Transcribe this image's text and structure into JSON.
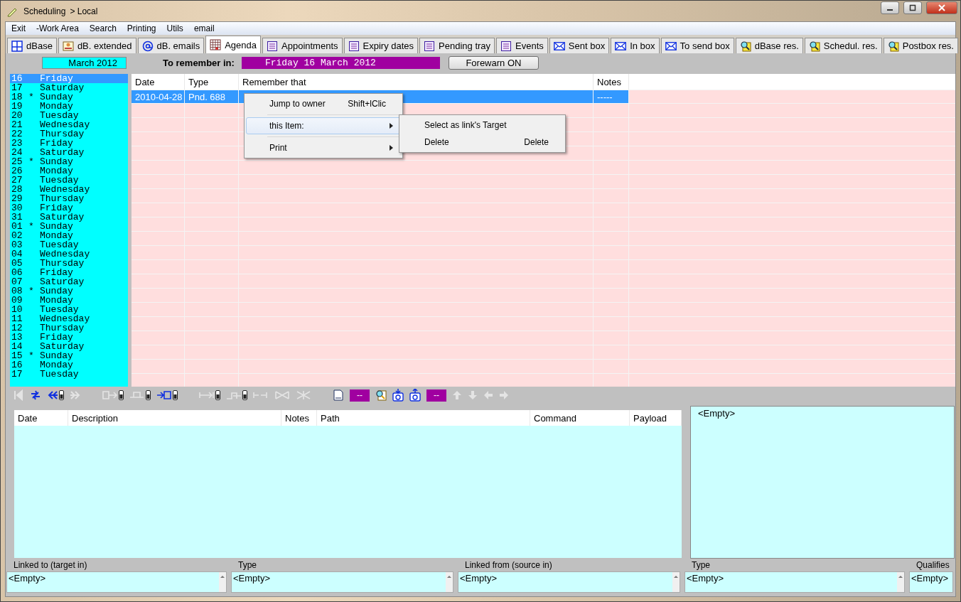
{
  "window": {
    "title": "Scheduling",
    "location": "> Local"
  },
  "menu": [
    "Exit",
    "-Work Area",
    "Search",
    "Printing",
    "Utils",
    "email"
  ],
  "tabs": [
    {
      "label": "dBase",
      "kind": "grid",
      "selected": false
    },
    {
      "label": "dB. extended",
      "kind": "card",
      "selected": false
    },
    {
      "label": "dB. emails",
      "kind": "at",
      "selected": false
    },
    {
      "label": "Agenda",
      "kind": "calendar",
      "selected": true
    },
    {
      "label": "Appointments",
      "kind": "page",
      "selected": false
    },
    {
      "label": "Expiry dates",
      "kind": "page",
      "selected": false
    },
    {
      "label": "Pending tray",
      "kind": "page",
      "selected": false
    },
    {
      "label": "Events",
      "kind": "page",
      "selected": false
    },
    {
      "label": "Sent box",
      "kind": "mail",
      "selected": false
    },
    {
      "label": "In box",
      "kind": "mail",
      "selected": false
    },
    {
      "label": "To send box",
      "kind": "mail",
      "selected": false
    },
    {
      "label": "dBase res.",
      "kind": "find",
      "selected": false
    },
    {
      "label": "Schedul. res.",
      "kind": "find",
      "selected": false
    },
    {
      "label": "Postbox res.",
      "kind": "find",
      "selected": false
    }
  ],
  "header": {
    "month": "March 2012",
    "remember_label": "To remember in:",
    "remember_date": "Friday 16 March 2012",
    "forewarn_button": "Forewarn ON"
  },
  "days": [
    {
      "day": "16",
      "weekday": "Friday",
      "selected": true
    },
    {
      "day": "17",
      "weekday": "Saturday",
      "selected": false
    },
    {
      "day": "18",
      "weekday": "Sunday",
      "mark": "*",
      "selected": false
    },
    {
      "day": "19",
      "weekday": "Monday",
      "selected": false
    },
    {
      "day": "20",
      "weekday": "Tuesday",
      "selected": false
    },
    {
      "day": "21",
      "weekday": "Wednesday",
      "selected": false
    },
    {
      "day": "22",
      "weekday": "Thursday",
      "selected": false
    },
    {
      "day": "23",
      "weekday": "Friday",
      "selected": false
    },
    {
      "day": "24",
      "weekday": "Saturday",
      "selected": false
    },
    {
      "day": "25",
      "weekday": "Sunday",
      "mark": "*",
      "selected": false
    },
    {
      "day": "26",
      "weekday": "Monday",
      "selected": false
    },
    {
      "day": "27",
      "weekday": "Tuesday",
      "selected": false
    },
    {
      "day": "28",
      "weekday": "Wednesday",
      "selected": false
    },
    {
      "day": "29",
      "weekday": "Thursday",
      "selected": false
    },
    {
      "day": "30",
      "weekday": "Friday",
      "selected": false
    },
    {
      "day": "31",
      "weekday": "Saturday",
      "selected": false
    },
    {
      "day": "01",
      "weekday": "Sunday",
      "mark": "*",
      "selected": false
    },
    {
      "day": "02",
      "weekday": "Monday",
      "selected": false
    },
    {
      "day": "03",
      "weekday": "Tuesday",
      "selected": false
    },
    {
      "day": "04",
      "weekday": "Wednesday",
      "selected": false
    },
    {
      "day": "05",
      "weekday": "Thursday",
      "selected": false
    },
    {
      "day": "06",
      "weekday": "Friday",
      "selected": false
    },
    {
      "day": "07",
      "weekday": "Saturday",
      "selected": false
    },
    {
      "day": "08",
      "weekday": "Sunday",
      "mark": "*",
      "selected": false
    },
    {
      "day": "09",
      "weekday": "Monday",
      "selected": false
    },
    {
      "day": "10",
      "weekday": "Tuesday",
      "selected": false
    },
    {
      "day": "11",
      "weekday": "Wednesday",
      "selected": false
    },
    {
      "day": "12",
      "weekday": "Thursday",
      "selected": false
    },
    {
      "day": "13",
      "weekday": "Friday",
      "selected": false
    },
    {
      "day": "14",
      "weekday": "Saturday",
      "selected": false
    },
    {
      "day": "15",
      "weekday": "Sunday",
      "mark": "*",
      "selected": false
    },
    {
      "day": "16",
      "weekday": "Monday",
      "selected": false
    },
    {
      "day": "17",
      "weekday": "Tuesday",
      "selected": false
    }
  ],
  "agenda_table": {
    "columns": [
      "Date",
      "Type",
      "Remember that",
      "Notes"
    ],
    "rows": [
      {
        "cells": [
          "2010-04-28",
          "Pnd. 688",
          "",
          "-----"
        ],
        "selected": true
      }
    ]
  },
  "context_menu": {
    "items": [
      {
        "label": "Jump to owner",
        "shortcut": "Shift+lClic",
        "submenu": false,
        "highlighted": false
      },
      {
        "label": "this Item:",
        "submenu": true,
        "highlighted": true
      },
      {
        "label": "Print",
        "submenu": true,
        "highlighted": false
      }
    ],
    "submenu": [
      {
        "label": "Select as link's Target"
      },
      {
        "label": "Delete",
        "shortcut": "Delete"
      }
    ]
  },
  "toolbar": [
    {
      "kind": "first",
      "disabled": true
    },
    {
      "kind": "swap",
      "disabled": false
    },
    {
      "kind": "back",
      "disabled": false,
      "dropdown": true
    },
    {
      "kind": "forward",
      "disabled": true
    },
    {
      "kind": "sep"
    },
    {
      "kind": "move-out",
      "disabled": true,
      "dropdown": true
    },
    {
      "kind": "base",
      "disabled": true,
      "dropdown": true
    },
    {
      "kind": "move-in",
      "disabled": false,
      "dropdown": true
    },
    {
      "kind": "sep"
    },
    {
      "kind": "to-end",
      "disabled": true,
      "dropdown": true
    },
    {
      "kind": "split",
      "disabled": true,
      "dropdown": true
    },
    {
      "kind": "shrink",
      "disabled": true
    },
    {
      "kind": "bow",
      "disabled": true
    },
    {
      "kind": "bow2",
      "disabled": true
    },
    {
      "kind": "sep"
    },
    {
      "kind": "doc"
    },
    {
      "kind": "field",
      "text": "--"
    },
    {
      "kind": "find"
    },
    {
      "kind": "mail-down",
      "disabled": false
    },
    {
      "kind": "mail-up",
      "disabled": false
    },
    {
      "kind": "field",
      "text": "--"
    },
    {
      "kind": "up",
      "disabled": true
    },
    {
      "kind": "down",
      "disabled": true
    },
    {
      "kind": "left",
      "disabled": true
    },
    {
      "kind": "right",
      "disabled": true
    }
  ],
  "links_table": {
    "columns": [
      "Date",
      "Description",
      "Notes",
      "Path",
      "Command",
      "Payload"
    ]
  },
  "preview": "<Empty>",
  "link_fields": [
    {
      "label": "Linked to (target in)",
      "value": "<Empty>"
    },
    {
      "label": "Type",
      "value": "<Empty>"
    },
    {
      "label": "Linked from (source in)",
      "value": "<Empty>"
    },
    {
      "label": "Type",
      "value": "<Empty>"
    },
    {
      "label": "Qualifies",
      "value": "<Empty>"
    }
  ]
}
